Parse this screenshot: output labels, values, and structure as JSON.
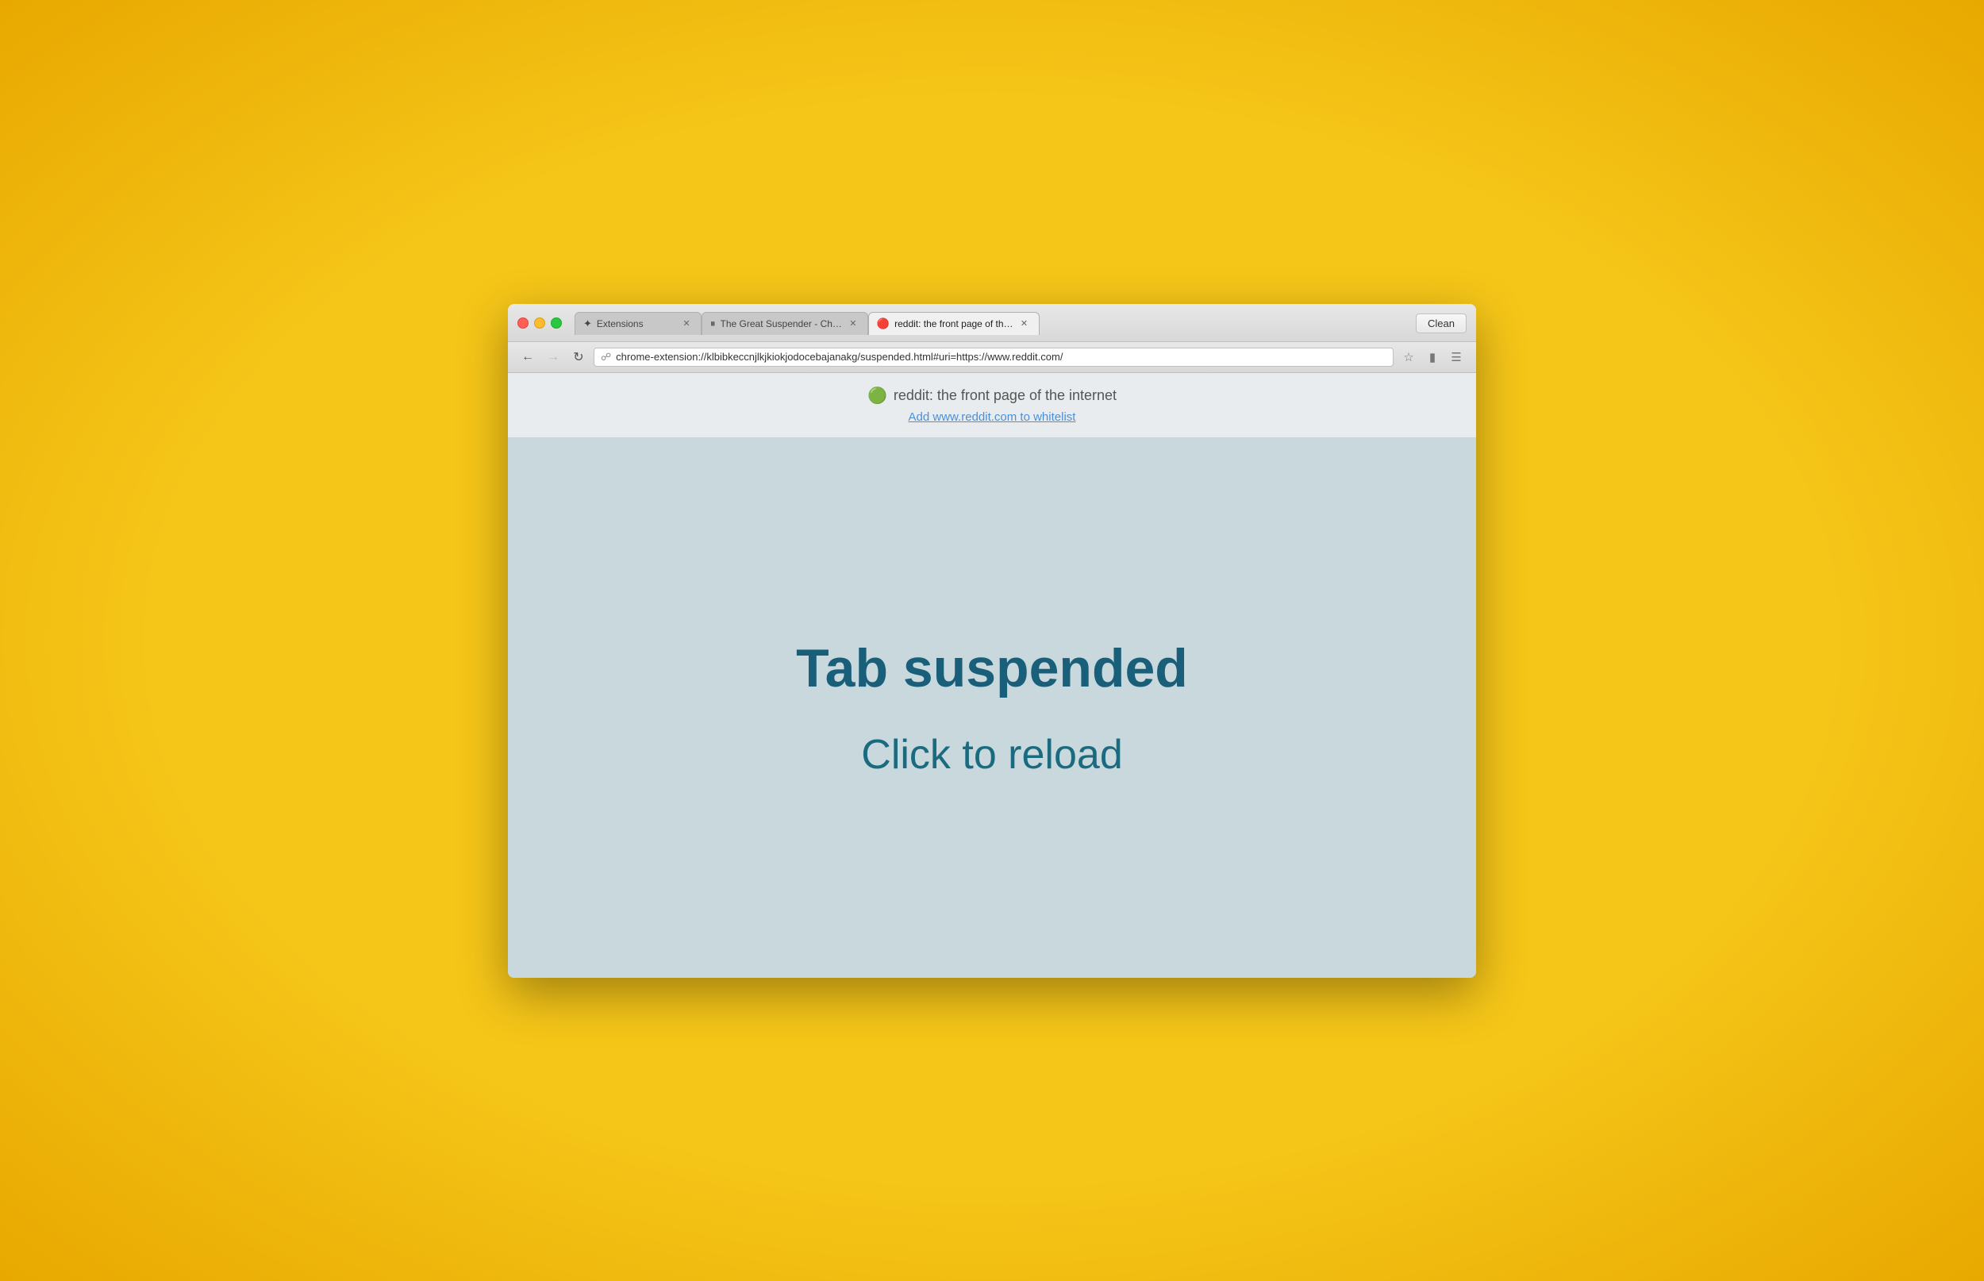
{
  "browser": {
    "clean_button": "Clean"
  },
  "tabs": [
    {
      "id": "extensions",
      "label": "Extensions",
      "icon": "⊞",
      "active": false,
      "closable": true
    },
    {
      "id": "great-suspender",
      "label": "The Great Suspender - Ch…",
      "icon": "⏸",
      "active": false,
      "closable": true
    },
    {
      "id": "reddit",
      "label": "reddit: the front page of th…",
      "icon": "🔴",
      "active": true,
      "closable": true
    },
    {
      "id": "new",
      "label": "",
      "icon": "",
      "active": false,
      "closable": false
    }
  ],
  "nav": {
    "back_disabled": false,
    "forward_disabled": true,
    "address": "chrome-extension://klbibkeccnjlkjkiokjodocebajanakg/suspended.html#uri=https://www.reddit.com/"
  },
  "page_header": {
    "site_title": "reddit: the front page of the internet",
    "whitelist_link": "Add www.reddit.com to whitelist"
  },
  "page_content": {
    "suspended_title": "Tab suspended",
    "reload_text": "Click to reload"
  }
}
